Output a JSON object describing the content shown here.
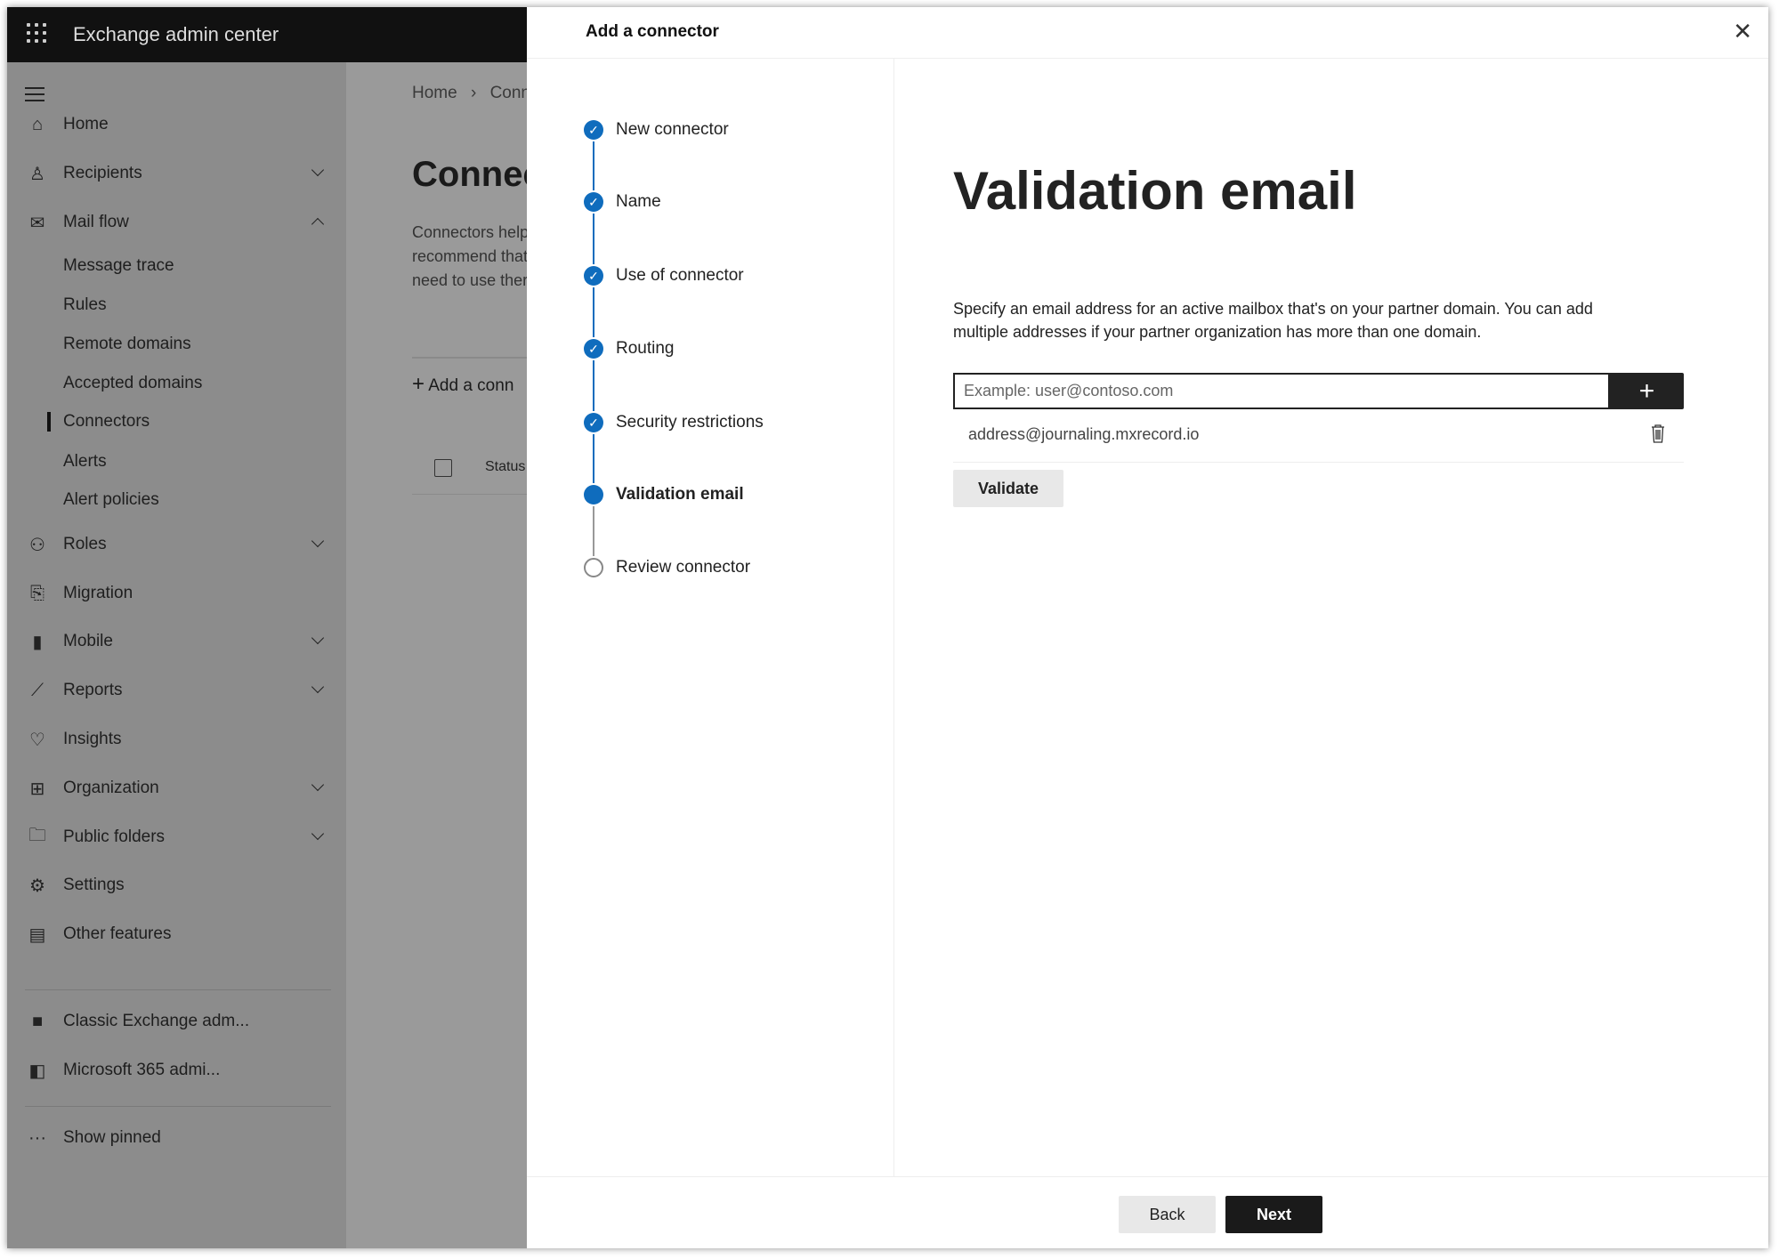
{
  "app": {
    "title": "Exchange admin center"
  },
  "sidebar": {
    "items": [
      {
        "label": "Home",
        "icon": "home-icon",
        "glyph": "⌂",
        "chevron": ""
      },
      {
        "label": "Recipients",
        "icon": "person-icon",
        "glyph": "♙",
        "chevron": "down"
      },
      {
        "label": "Mail flow",
        "icon": "mail-icon",
        "glyph": "✉",
        "chevron": "up"
      },
      {
        "label": "Message trace",
        "sub": true
      },
      {
        "label": "Rules",
        "sub": true
      },
      {
        "label": "Remote domains",
        "sub": true
      },
      {
        "label": "Accepted domains",
        "sub": true
      },
      {
        "label": "Connectors",
        "sub": true,
        "selected": true
      },
      {
        "label": "Alerts",
        "sub": true
      },
      {
        "label": "Alert policies",
        "sub": true
      },
      {
        "label": "Roles",
        "icon": "roles-icon",
        "glyph": "⚇",
        "chevron": "down"
      },
      {
        "label": "Migration",
        "icon": "migration-icon",
        "glyph": "⎘",
        "chevron": ""
      },
      {
        "label": "Mobile",
        "icon": "mobile-icon",
        "glyph": "▮",
        "chevron": "down"
      },
      {
        "label": "Reports",
        "icon": "chart-icon",
        "glyph": "⟋",
        "chevron": "down"
      },
      {
        "label": "Insights",
        "icon": "lightbulb-icon",
        "glyph": "♡",
        "chevron": ""
      },
      {
        "label": "Organization",
        "icon": "org-icon",
        "glyph": "⊞",
        "chevron": "down"
      },
      {
        "label": "Public folders",
        "icon": "folder-globe-icon",
        "glyph": "🗀",
        "chevron": "down"
      },
      {
        "label": "Settings",
        "icon": "gear-icon",
        "glyph": "⚙",
        "chevron": ""
      },
      {
        "label": "Other features",
        "icon": "table-icon",
        "glyph": "▤",
        "chevron": ""
      }
    ],
    "links": [
      {
        "label": "Classic Exchange adm...",
        "icon": "exchange-icon",
        "glyph": "■"
      },
      {
        "label": "Microsoft 365 admi...",
        "icon": "office-icon",
        "glyph": "◧"
      }
    ],
    "show_pinned": "Show pinned"
  },
  "main": {
    "breadcrumb": [
      "Home",
      "Conne"
    ],
    "title": "Connec",
    "desc": [
      "Connectors help",
      "recommend that",
      "need to use ther"
    ],
    "add_label": "Add a conn",
    "col_status": "Status"
  },
  "panel": {
    "title": "Add a connector",
    "steps": [
      {
        "label": "New connector",
        "state": "done"
      },
      {
        "label": "Name",
        "state": "done"
      },
      {
        "label": "Use of connector",
        "state": "done"
      },
      {
        "label": "Routing",
        "state": "done"
      },
      {
        "label": "Security restrictions",
        "state": "done"
      },
      {
        "label": "Validation email",
        "state": "current"
      },
      {
        "label": "Review connector",
        "state": "pending"
      }
    ],
    "heading": "Validation email",
    "description": "Specify an email address for an active mailbox that's on your partner domain. You can add multiple addresses if your partner organization has more than one domain.",
    "input_placeholder": "Example: user@contoso.com",
    "input_value": "",
    "addresses": [
      "address@journaling.mxrecord.io"
    ],
    "validate_label": "Validate",
    "back_label": "Back",
    "next_label": "Next"
  },
  "colors": {
    "accent": "#0f6cbd",
    "topbar": "#111111",
    "primary_button": "#1a1a1a"
  }
}
